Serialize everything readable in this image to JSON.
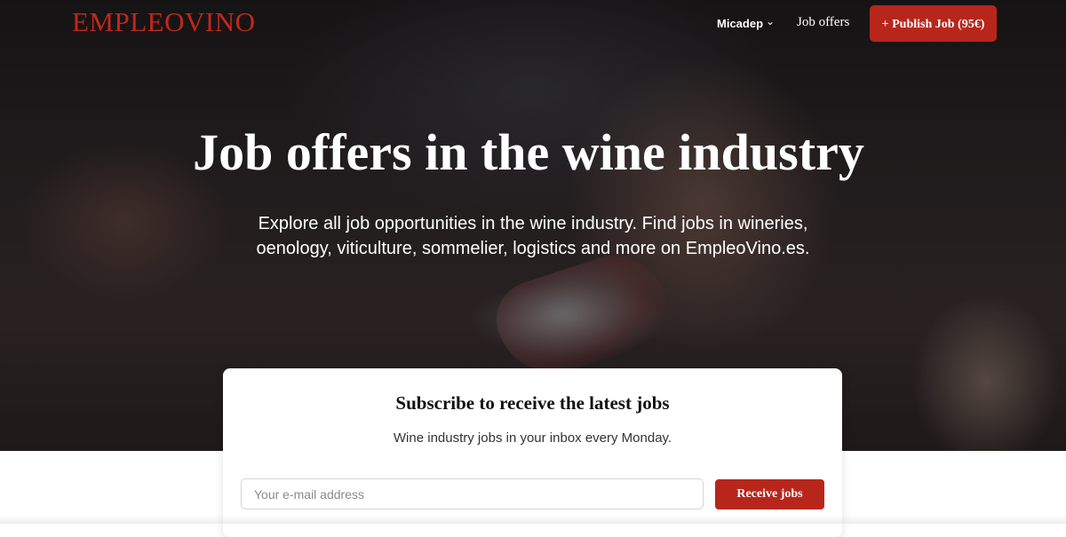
{
  "header": {
    "logo_text": "EMPLEOVINO",
    "user_menu_label": "Micadep",
    "nav_link_label": "Job offers",
    "publish_button_label": "+ Publish Job (95€)",
    "accent_color": "#b8261b"
  },
  "hero": {
    "title": "Job offers in the wine industry",
    "subtitle": "Explore all job opportunities in the wine industry. Find jobs in wineries, oenology, viticulture, sommelier, logistics and more on EmpleoVino.es."
  },
  "subscribe": {
    "title": "Subscribe to receive the latest jobs",
    "subtitle": "Wine industry jobs in your inbox every Monday.",
    "email_placeholder": "Your e-mail address",
    "button_label": "Receive jobs"
  },
  "icons": {
    "user_menu_chevron": "chevron-down-icon"
  }
}
